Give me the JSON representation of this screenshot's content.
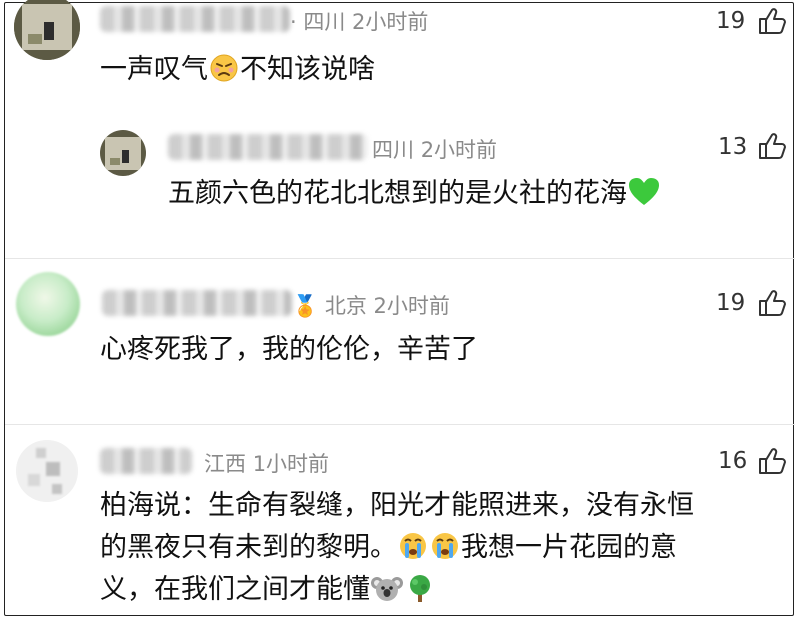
{
  "comments": [
    {
      "location": "四川",
      "time": "2小时前",
      "likes": "19",
      "text": "一声叹气",
      "text_after": "不知该说啥",
      "emoji": "weary-face-icon",
      "replies": [
        {
          "location": "四川",
          "time": "2小时前",
          "likes": "13",
          "text": "五颜六色的花北北想到的是火社的花海",
          "emoji": "green-heart-icon"
        }
      ]
    },
    {
      "location": "北京",
      "time": "2小时前",
      "likes": "19",
      "text": "心疼死我了，我的伦伦，辛苦了"
    },
    {
      "location": "江西",
      "time": "1小时前",
      "likes": "16",
      "text_lines": [
        "柏海说：生命有裂缝，阳光才能照进来，没有永恒",
        "的黑夜只有未到的黎明。",
        "我想一片花园的意",
        "义，在我们之间才能懂"
      ],
      "emojis": [
        "crying-face-icon",
        "crying-face-icon",
        "koala-icon",
        "tree-icon"
      ]
    }
  ],
  "colors": {
    "meta": "#8a8a8a",
    "text": "#111111",
    "heart": "#3cc93c"
  }
}
